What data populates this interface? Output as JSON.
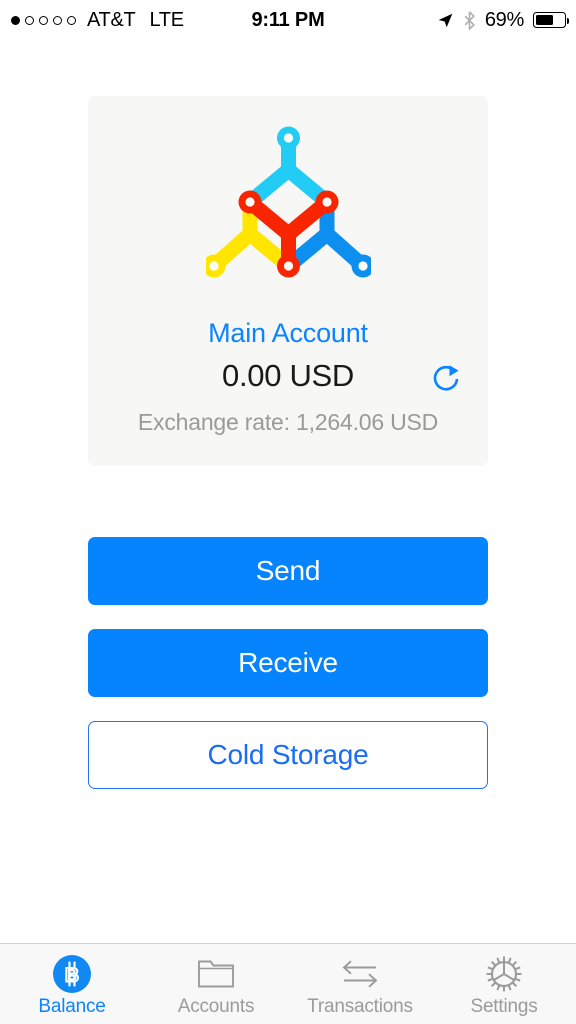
{
  "status_bar": {
    "signal_dots_total": 5,
    "signal_dots_filled": 1,
    "carrier": "AT&T",
    "network": "LTE",
    "time": "9:11 PM",
    "battery_percent": "69%",
    "battery_level": 69,
    "location_icon": "location-arrow-icon",
    "bluetooth_icon": "bluetooth-icon",
    "battery_icon": "battery-icon"
  },
  "card": {
    "logo_name": "molecule-network-logo",
    "logo_colors": {
      "cyan": "#22CCF5",
      "red": "#F72500",
      "yellow": "#FFE500",
      "blue": "#0D8FF0"
    },
    "account_name": "Main Account",
    "balance": "0.00 USD",
    "exchange_rate": "Exchange rate: 1,264.06 USD",
    "refresh_icon": "refresh-icon",
    "background": "#F7F7F5"
  },
  "actions": {
    "send_label": "Send",
    "receive_label": "Receive",
    "cold_storage_label": "Cold Storage",
    "primary_color": "#0584FE",
    "outline_color": "#2573F0"
  },
  "tabbar": {
    "active_color": "#0A84FF",
    "inactive_color": "#9B9B9B",
    "items": [
      {
        "label": "Balance",
        "icon": "bitcoin-icon",
        "active": true
      },
      {
        "label": "Accounts",
        "icon": "folder-icon",
        "active": false
      },
      {
        "label": "Transactions",
        "icon": "swap-arrows-icon",
        "active": false
      },
      {
        "label": "Settings",
        "icon": "gear-icon",
        "active": false
      }
    ]
  }
}
